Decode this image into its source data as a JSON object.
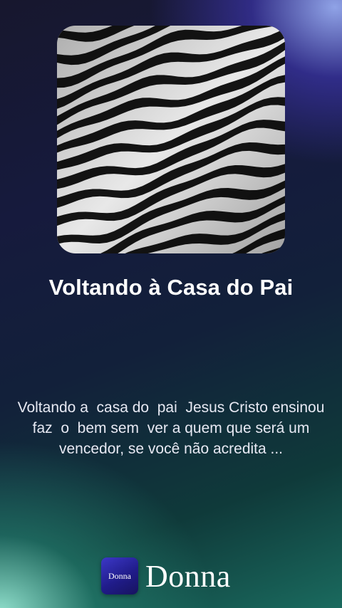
{
  "track": {
    "title": "Voltando à Casa do Pai",
    "description": "Voltando a  casa do  pai  Jesus Cristo ensinou  faz  o  bem sem  ver a quem que será um vencedor, se você não acredita ..."
  },
  "brand": {
    "icon_text": "Donna",
    "name": "Donna"
  },
  "colors": {
    "accent_top_right": "#8aa0f0",
    "accent_bottom_left": "#8fe0cc",
    "brand_icon": "#2b27a8"
  },
  "icons": {
    "cover": "zebra-stripe-artwork",
    "brand": "donna-logo-icon"
  }
}
